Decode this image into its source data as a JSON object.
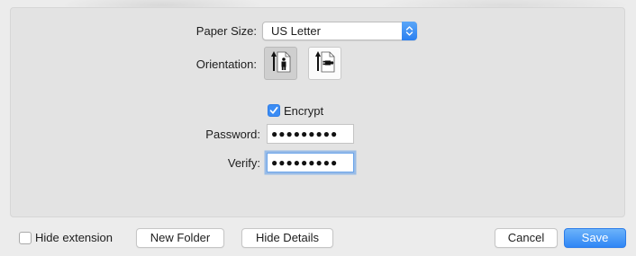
{
  "dialog": {
    "paper_size": {
      "label": "Paper Size:",
      "value": "US Letter"
    },
    "orientation": {
      "label": "Orientation:",
      "selected": "portrait",
      "options": [
        "portrait",
        "landscape"
      ]
    },
    "encrypt": {
      "label": "Encrypt",
      "checked": true
    },
    "password": {
      "label": "Password:",
      "value": "●●●●●●●●●"
    },
    "verify": {
      "label": "Verify:",
      "value": "●●●●●●●●●"
    }
  },
  "footer": {
    "hide_extension": {
      "label": "Hide extension",
      "checked": false
    },
    "new_folder_label": "New Folder",
    "hide_details_label": "Hide Details",
    "cancel_label": "Cancel",
    "save_label": "Save"
  },
  "colors": {
    "accent": "#3b8cf4",
    "window_bg": "#ececec",
    "panel_bg": "#e3e3e3"
  },
  "icons": {
    "popup_arrows": "up-down-chevrons-icon",
    "portrait": "portrait-orientation-icon",
    "landscape": "landscape-orientation-icon",
    "checkmark": "checkmark-icon"
  }
}
